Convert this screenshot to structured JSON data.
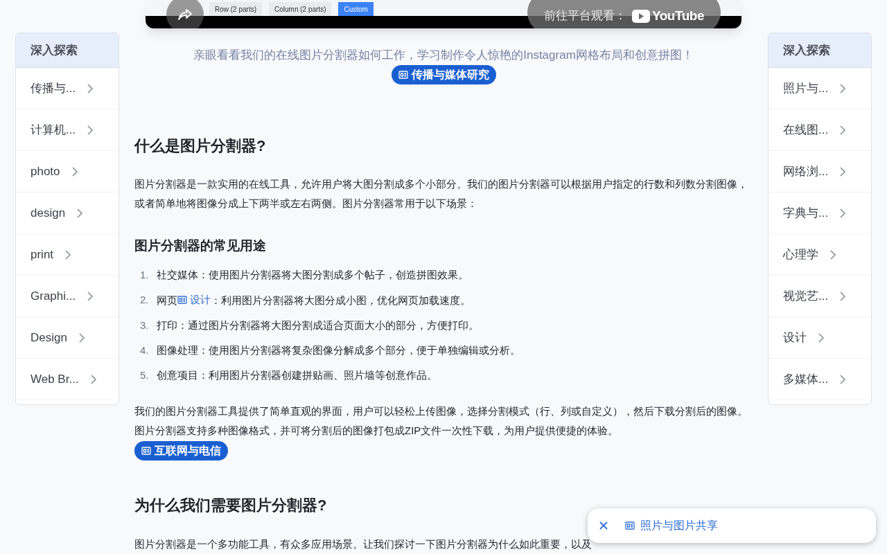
{
  "video": {
    "buttons": [
      {
        "label": "Row (2 parts)",
        "selected": false
      },
      {
        "label": "Column (2 parts)",
        "selected": false
      },
      {
        "label": "Custom",
        "selected": true
      }
    ],
    "watch_on": "前往平台观看：",
    "platform": "YouTube"
  },
  "left_sidebar": {
    "title": "深入探索",
    "items": [
      "传播与...",
      "计算机...",
      "photo",
      "design",
      "print",
      "Graphi...",
      "Design",
      "Web Br..."
    ]
  },
  "right_sidebar": {
    "title": "深入探索",
    "items": [
      "照片与...",
      "在线图...",
      "网络浏...",
      "字典与...",
      "心理学",
      "视觉艺...",
      "设计",
      "多媒体..."
    ]
  },
  "caption": "亲眼看看我们的在线图片分割器如何工作，学习制作令人惊艳的Instagram网格布局和创意拼图！",
  "caption_tag": "传播与媒体研究",
  "sections": [
    {
      "heading": "什么是图片分割器?",
      "intro": "图片分割器是一款实用的在线工具，允许用户将大图分割成多个小部分。我们的图片分割器可以根据用户指定的行数和列数分割图像，或者简单地将图像分成上下两半或左右两侧。图片分割器常用于以下场景：",
      "subheading": "图片分割器的常见用途",
      "list": [
        {
          "number": "1.",
          "text": "社交媒体：使用图片分割器将大图分割成多个帖子，创造拼图效果。"
        },
        {
          "number": "2.",
          "before": "网页",
          "link": "设计",
          "text": "：利用图片分割器将大图分成小图，优化网页加载速度。"
        },
        {
          "number": "3.",
          "text": "打印：通过图片分割器将大图分割成适合页面大小的部分，方便打印。"
        },
        {
          "number": "4.",
          "text": "图像处理：使用图片分割器将复杂图像分解成多个部分，便于单独编辑或分析。"
        },
        {
          "number": "5.",
          "text": "创意项目：利用图片分割器创建拼贴画、照片墙等创意作品。"
        }
      ],
      "outro": "我们的图片分割器工具提供了简单直观的界面，用户可以轻松上传图像，选择分割模式（行、列或自定义），然后下载分割后的图像。图片分割器支持多种图像格式，并可将分割后的图像打包成ZIP文件一次性下载，为用户提供便捷的体验。",
      "tag": "互联网与电信"
    },
    {
      "heading": "为什么我们需要图片分割器?",
      "intro": "图片分割器是一个多功能工具，有众多应用场景。让我们探讨一下图片分割器为什么如此重要，以及"
    }
  ],
  "popup": {
    "label": "照片与图片共享"
  }
}
